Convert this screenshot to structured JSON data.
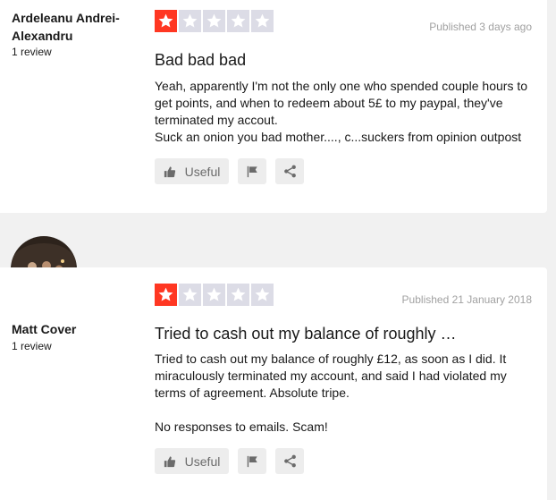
{
  "reviews": [
    {
      "author": "Ardeleanu Andrei-Alexandru",
      "review_count": "1 review",
      "rating": 1,
      "published": "Published 3 days ago",
      "title": "Bad bad bad",
      "body": "Yeah, apparently I'm not the only one who spended couple hours to get points, and when to redeem about 5£ to my paypal, they've terminated my accout.\nSuck an onion you bad mother...., c...suckers from opinion outpost",
      "useful_label": "Useful"
    },
    {
      "author": "Matt Cover",
      "review_count": "1 review",
      "rating": 1,
      "published": "Published 21 January 2018",
      "title": "Tried to cash out my balance of roughly …",
      "body": "Tried to cash out my balance of roughly £12, as soon as I did. It miraculously terminated my account, and said I had violated my terms of agreement. Absolute tripe.\n\nNo responses to emails. Scam!",
      "useful_label": "Useful"
    }
  ],
  "colors": {
    "star_filled": "#ff3722",
    "star_empty": "#dcdce6"
  },
  "icons": {
    "star": "star-icon",
    "useful": "thumbs-up-icon",
    "flag": "flag-icon",
    "share": "share-icon"
  }
}
